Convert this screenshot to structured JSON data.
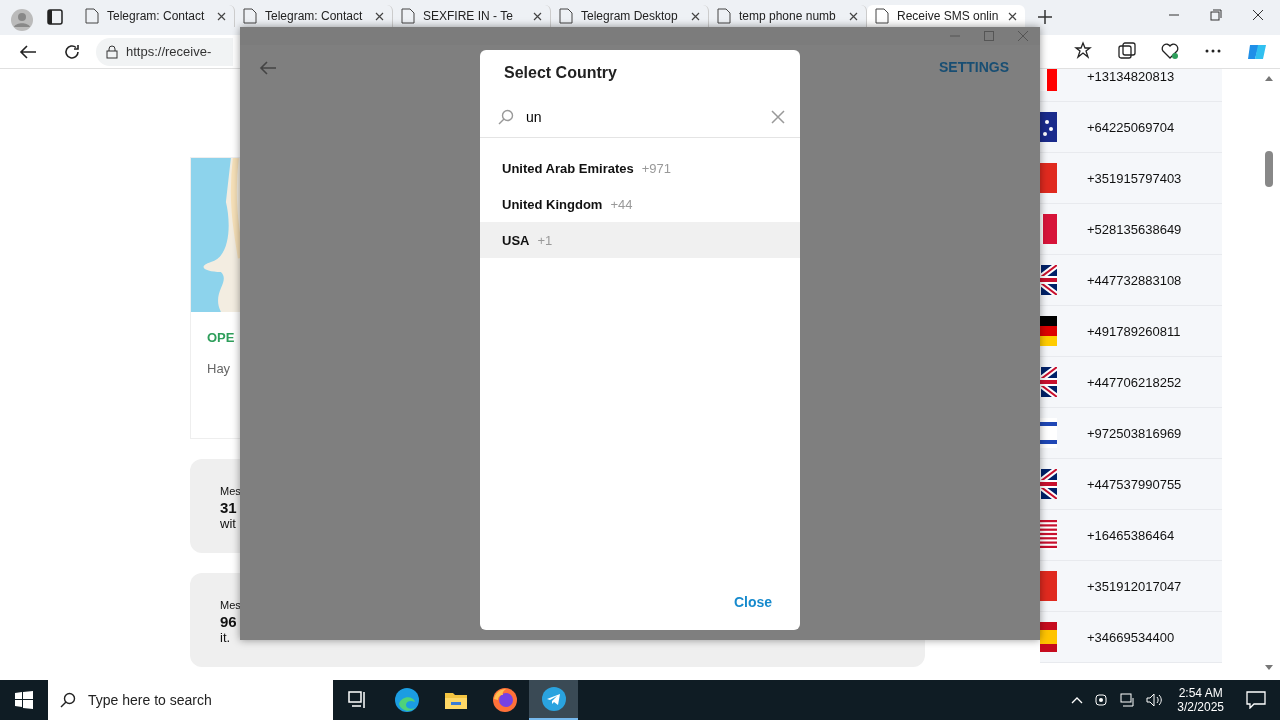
{
  "browser": {
    "tabs": [
      {
        "title": "Telegram: Contact",
        "selected": false
      },
      {
        "title": "Telegram: Contact",
        "selected": false
      },
      {
        "title": "SEXFIRE IN - Te",
        "selected": false
      },
      {
        "title": "Telegram Desktop",
        "selected": false
      },
      {
        "title": "temp phone numb",
        "selected": false
      },
      {
        "title": "Receive SMS onlin",
        "selected": true
      }
    ],
    "address": "https://receive-"
  },
  "page": {
    "place_card": {
      "status": "OPE",
      "text": "Hay"
    },
    "messages": [
      {
        "label": "Mes",
        "number": "31",
        "text": "wit"
      },
      {
        "label": "Mes",
        "number": "96",
        "text": "it."
      }
    ],
    "numbers": [
      "+13134820813",
      "+64225069704",
      "+351915797403",
      "+528135638649",
      "+447732883108",
      "+491789260811",
      "+447706218252",
      "+972503816969",
      "+447537990755",
      "+16465386464",
      "+351912017047",
      "+34669534400"
    ]
  },
  "telegram": {
    "settings": "SETTINGS",
    "dialog": {
      "title": "Select Country",
      "search": {
        "value": "un"
      },
      "countries": [
        {
          "name": "United Arab Emirates",
          "code": "+971",
          "selected": false
        },
        {
          "name": "United Kingdom",
          "code": "+44",
          "selected": false
        },
        {
          "name": "USA",
          "code": "+1",
          "selected": true
        }
      ],
      "close_button": "Close"
    }
  },
  "taskbar": {
    "search_placeholder": "Type here to search",
    "apps": [
      {
        "kind": "taskview",
        "active": false
      },
      {
        "kind": "edge",
        "active": false
      },
      {
        "kind": "files",
        "active": false
      },
      {
        "kind": "firefox",
        "active": false
      },
      {
        "kind": "telegram",
        "active": true
      }
    ],
    "time": "2:54 AM",
    "date": "3/2/2025"
  }
}
